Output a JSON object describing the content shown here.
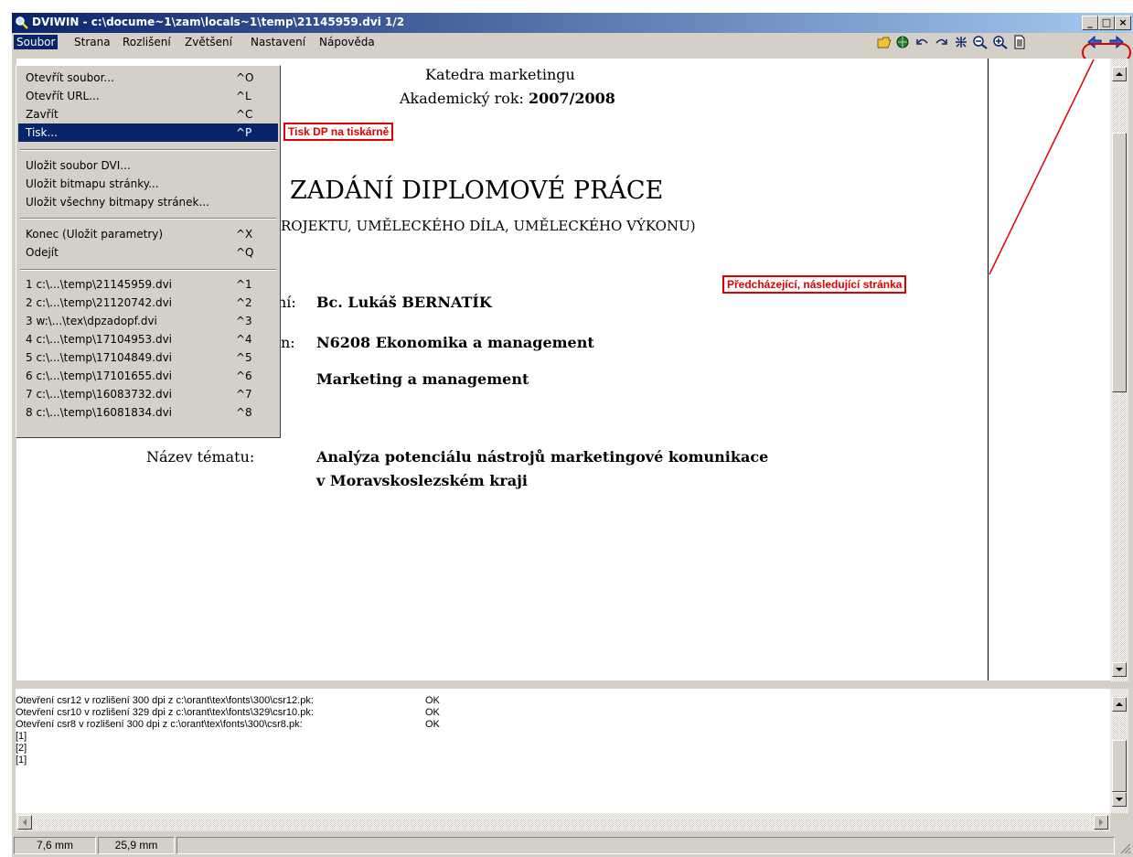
{
  "window": {
    "title": "DVIWIN - c:\\docume~1\\zam\\locals~1\\temp\\21145959.dvi  1/2"
  },
  "menubar": [
    "Soubor",
    "Strana",
    "Rozlišení",
    "Zvětšení",
    "Nastavení",
    "Nápověda"
  ],
  "toolbar": {
    "icons": [
      "open-folder-icon",
      "open-url-icon",
      "undo-icon",
      "redo-icon",
      "fit-icon",
      "zoom-out-icon",
      "zoom-in-icon",
      "page-icon",
      "previous-page-icon",
      "next-page-icon"
    ]
  },
  "file_menu": {
    "group1": [
      {
        "label": "Otevřít soubor...",
        "shortcut": "^O"
      },
      {
        "label": "Otevřít URL...",
        "shortcut": "^L"
      },
      {
        "label": "Zavřít",
        "shortcut": "^C"
      },
      {
        "label": "Tisk...",
        "shortcut": "^P"
      }
    ],
    "group2": [
      {
        "label": "Uložit soubor DVI..."
      },
      {
        "label": "Uložit bitmapu stránky..."
      },
      {
        "label": "Uložit všechny bitmapy stránek..."
      }
    ],
    "group3": [
      {
        "label": "Konec  (Uložit parametry)",
        "shortcut": "^X"
      },
      {
        "label": "Odejít",
        "shortcut": "^Q"
      }
    ],
    "recent": [
      {
        "label": "1 c:\\...\\temp\\21145959.dvi",
        "shortcut": "^1"
      },
      {
        "label": "2 c:\\...\\temp\\21120742.dvi",
        "shortcut": "^2"
      },
      {
        "label": "3 w:\\...\\tex\\dpzadopf.dvi",
        "shortcut": "^3"
      },
      {
        "label": "4 c:\\...\\temp\\17104953.dvi",
        "shortcut": "^4"
      },
      {
        "label": "5 c:\\...\\temp\\17104849.dvi",
        "shortcut": "^5"
      },
      {
        "label": "6 c:\\...\\temp\\17101655.dvi",
        "shortcut": "^6"
      },
      {
        "label": "7 c:\\...\\temp\\16083732.dvi",
        "shortcut": "^7"
      },
      {
        "label": "8 c:\\...\\temp\\16081834.dvi",
        "shortcut": "^8"
      }
    ]
  },
  "document": {
    "dept": "Katedra marketingu",
    "year_label": "Akademický rok: ",
    "year": "2007/2008",
    "heading": "ZADÁNÍ DIPLOMOVÉ PRÁCE",
    "subheading": "ROJEKTU, UMĚLECKÉHO DÍLA, UMĚLECKÉHO VÝKONU)",
    "field1_label": "ní:",
    "field1_value": "Bc. Lukáš BERNATÍK",
    "field2_label": "n:",
    "field2_value": "N6208 Ekonomika a management",
    "field3_value": "Marketing a management",
    "topic_label": "Název tématu:",
    "topic_line1": "Analýza potenciálu nástrojů marketingové komunikace",
    "topic_line2": "v Moravskoslezském kraji"
  },
  "callouts": {
    "print": "Tisk DP na tiskárně",
    "nav": "Předcházející, následující stránka"
  },
  "log": [
    "Otevření csr12 v rozlišení 300 dpi z c:\\orant\\tex\\fonts\\300\\csr12.pk:",
    "Otevření csr10 v rozlišení 329 dpi z c:\\orant\\tex\\fonts\\329\\csr10.pk:",
    "Otevření csr8 v rozlišení 300 dpi z c:\\orant\\tex\\fonts\\300\\csr8.pk:",
    "[1]",
    "[2]",
    "[1]"
  ],
  "log_status": [
    "OK",
    "OK",
    "OK"
  ],
  "status": {
    "x": "7,6 mm",
    "y": "25,9 mm"
  },
  "colors": {
    "titlebar": "#0a246a",
    "menu_highlight": "#0a246a",
    "callout": "#e00000"
  }
}
